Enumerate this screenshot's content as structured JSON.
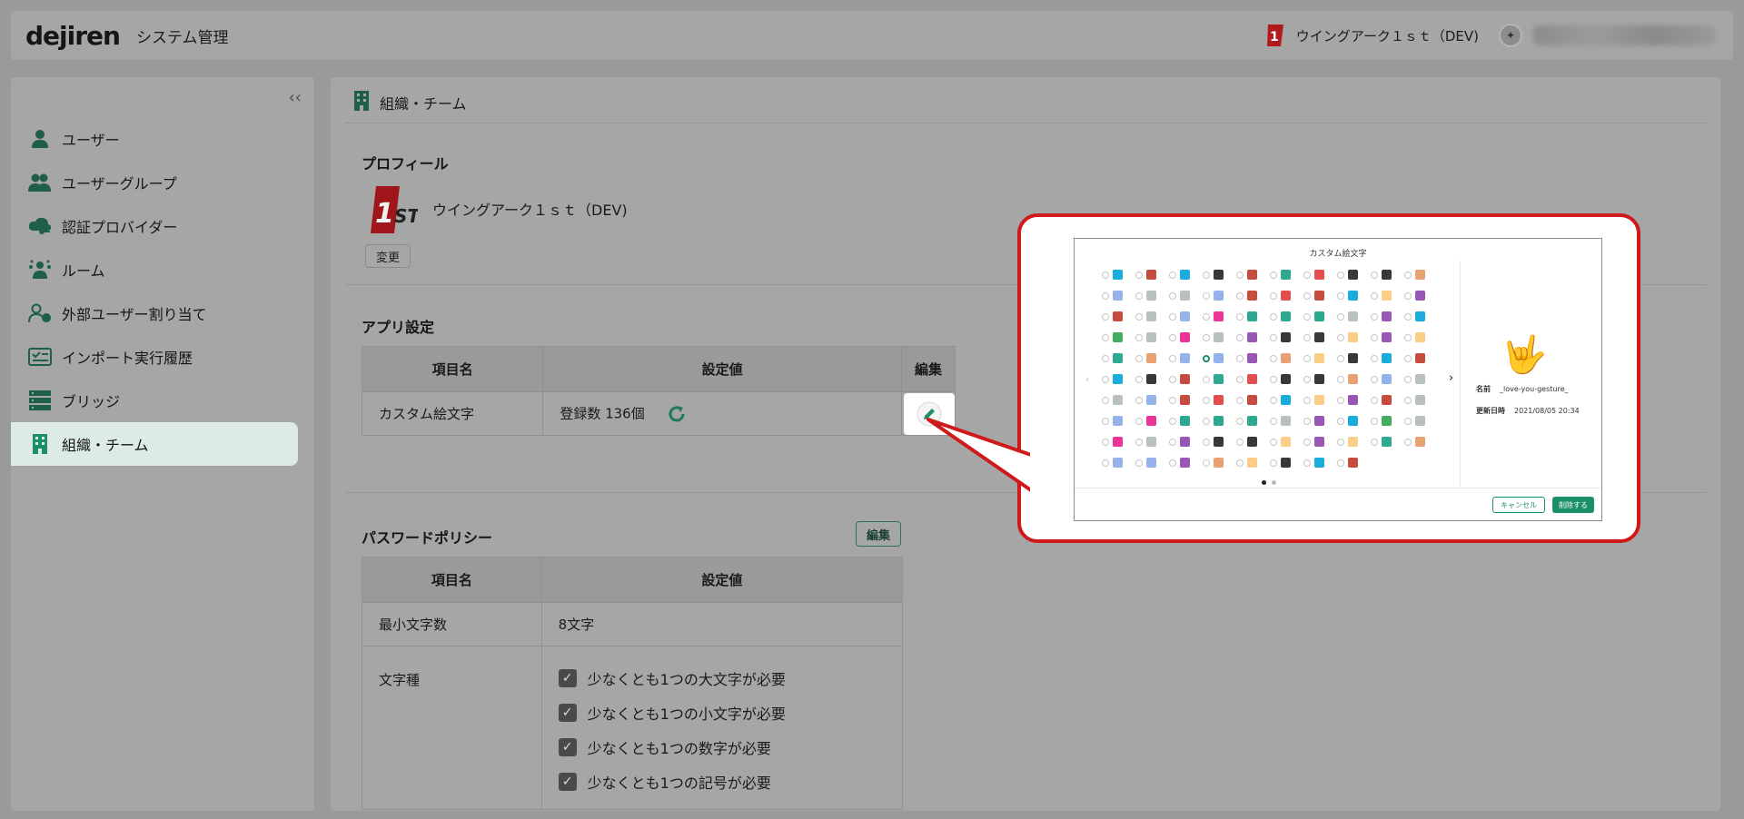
{
  "header": {
    "logo": "dejiren",
    "app_title": "システム管理",
    "org_name": "ウイングアーク１ｓｔ（DEV)"
  },
  "sidebar": {
    "collapse_glyph": "‹‹",
    "items": [
      {
        "label": "ユーザー",
        "icon": "user-icon"
      },
      {
        "label": "ユーザーグループ",
        "icon": "users-icon"
      },
      {
        "label": "認証プロバイダー",
        "icon": "cloud-key-icon"
      },
      {
        "label": "ルーム",
        "icon": "room-icon"
      },
      {
        "label": "外部ユーザー割り当て",
        "icon": "external-user-icon"
      },
      {
        "label": "インポート実行履歴",
        "icon": "import-history-icon"
      },
      {
        "label": "ブリッジ",
        "icon": "bridge-icon"
      },
      {
        "label": "組織・チーム",
        "icon": "building-icon"
      }
    ]
  },
  "main": {
    "breadcrumb": "組織・チーム",
    "profile": {
      "heading": "プロフィール",
      "org_name": "ウイングアーク１ｓｔ（DEV)",
      "change_label": "変更"
    },
    "app_settings": {
      "heading": "アプリ設定",
      "columns": [
        "項目名",
        "設定値",
        "編集"
      ],
      "row": {
        "name": "カスタム絵文字",
        "value": "登録数 136個"
      }
    },
    "password_policy": {
      "heading": "パスワードポリシー",
      "edit_label": "編集",
      "columns": [
        "項目名",
        "設定値"
      ],
      "min_length_label": "最小文字数",
      "min_length_value": "8文字",
      "char_types_label": "文字種",
      "rules": [
        "少なくとも1つの大文字が必要",
        "少なくとも1つの小文字が必要",
        "少なくとも1つの数字が必要",
        "少なくとも1つの記号が必要"
      ]
    }
  },
  "callout": {
    "title": "カスタム絵文字",
    "name_label": "名前",
    "name_value": "_love-you-gesture_",
    "updated_label": "更新日時",
    "updated_value": "2021/08/05 20:34",
    "cancel_label": "キャンセル",
    "delete_label": "削除する",
    "emoji": "🤟"
  },
  "colors": {
    "accent": "#1c8f68",
    "callout_border": "#d0191b"
  }
}
